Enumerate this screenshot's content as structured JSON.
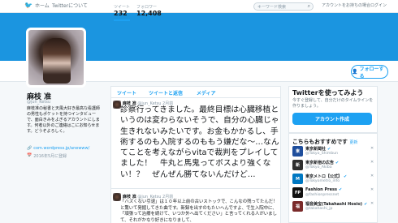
{
  "nav": {
    "home_label": "ホーム",
    "about_label": "Twitterについて",
    "search_placeholder": "キーワード検索",
    "right_text": "アカウントをお持ちの場合ログイン"
  },
  "profile": {
    "name": "麻枝 准",
    "handle": "@jun_Ketsu",
    "bio": "麻枝准の秘書と天風大好き最高な看護師の男性もポケットを持つインタビューで、面白きみをよぎるアカウントにします。何者以外のご連絡はこにお知らせます。どうぞよろしく。",
    "link": "com.wordpress.jp/anewww/",
    "joined": "2016年5月に登録"
  },
  "stats": [
    {
      "label": "ツイート",
      "value": "232"
    },
    {
      "label": "フォロワー",
      "value": "12,408"
    }
  ],
  "follow_label": "フォローする",
  "tabs": [
    "ツイート",
    "ツイートと返信",
    "メディア"
  ],
  "tweets": [
    {
      "name": "麻枝 准",
      "handle": "@jun_Ketsu",
      "time": "2月前",
      "text": "診察行ってきました。最終目標は心臓移植というのは変わらないそうで、自分の心臓じゃ生きれないみたいです。お金もかかるし、手術するのも入院するのももう嫌だな〜…なんてことを考えながらvitaで裁判をプレイしてました！　牛丸と馬鬼ってボスより強くない！？　ぜんぜん勝てないんだけど…"
    },
    {
      "name": "麻枝 准",
      "handle": "@jun_Ketsu",
      "time": "2月前",
      "text": "「ハズくない引退」は１０年以上前の古いストックで、こんなの残ってたんだ！と驚いて発掘してきた曲です。新録を出すのもたいへんですよ、で生入院中に、「頑張って治療を続けて、いつか外へ出てください」と言ってくれる人がいまして、それがかなり好きになりまして、"
    }
  ],
  "cta": {
    "title": "Twitterを使ってみよう",
    "subtitle": "今すぐ登録して、自分だけのタイムラインを作りましょう。",
    "button": "アカウント作成"
  },
  "suggestions": {
    "title": "こちらもおすすめです",
    "refresh": "更新",
    "accounts": [
      {
        "name": "東京新聞社",
        "handle": "@Tokyo_Shimbun",
        "avatar_text": "東",
        "color": "#1f4e9c"
      },
      {
        "name": "東京新宿の広告",
        "handle": "@Tokyo_Akiba",
        "avatar_text": "新",
        "color": "#2f2f2f"
      },
      {
        "name": "東京メトロ【公式】",
        "handle": "@Tokyometro_info",
        "avatar_text": "M",
        "color": "#0078c2"
      },
      {
        "name": "Fashion Press",
        "handle": "@fashionpressnet",
        "avatar_text": "FP",
        "color": "#111111"
      },
      {
        "name": "福音美宝(Takahashi Hosio)",
        "handle": "@takahashi_jp",
        "avatar_text": "福",
        "color": "#7a2a2a"
      }
    ]
  },
  "colors": {
    "banner": "#1b95e0",
    "accent": "#1da1f2"
  }
}
